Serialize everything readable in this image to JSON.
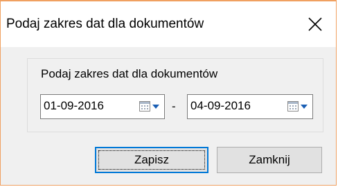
{
  "window": {
    "title": "Podaj zakres dat dla dokumentów",
    "close_icon": "close-icon",
    "border_color": "#f0a060"
  },
  "range": {
    "label": "Podaj zakres dat dla dokumentów",
    "from": "01-09-2016",
    "separator": "-",
    "to": "04-09-2016",
    "calendar_icon": "calendar-dropdown-icon"
  },
  "buttons": {
    "save": "Zapisz",
    "close": "Zamknij"
  },
  "colors": {
    "accent": "#0078d7"
  }
}
